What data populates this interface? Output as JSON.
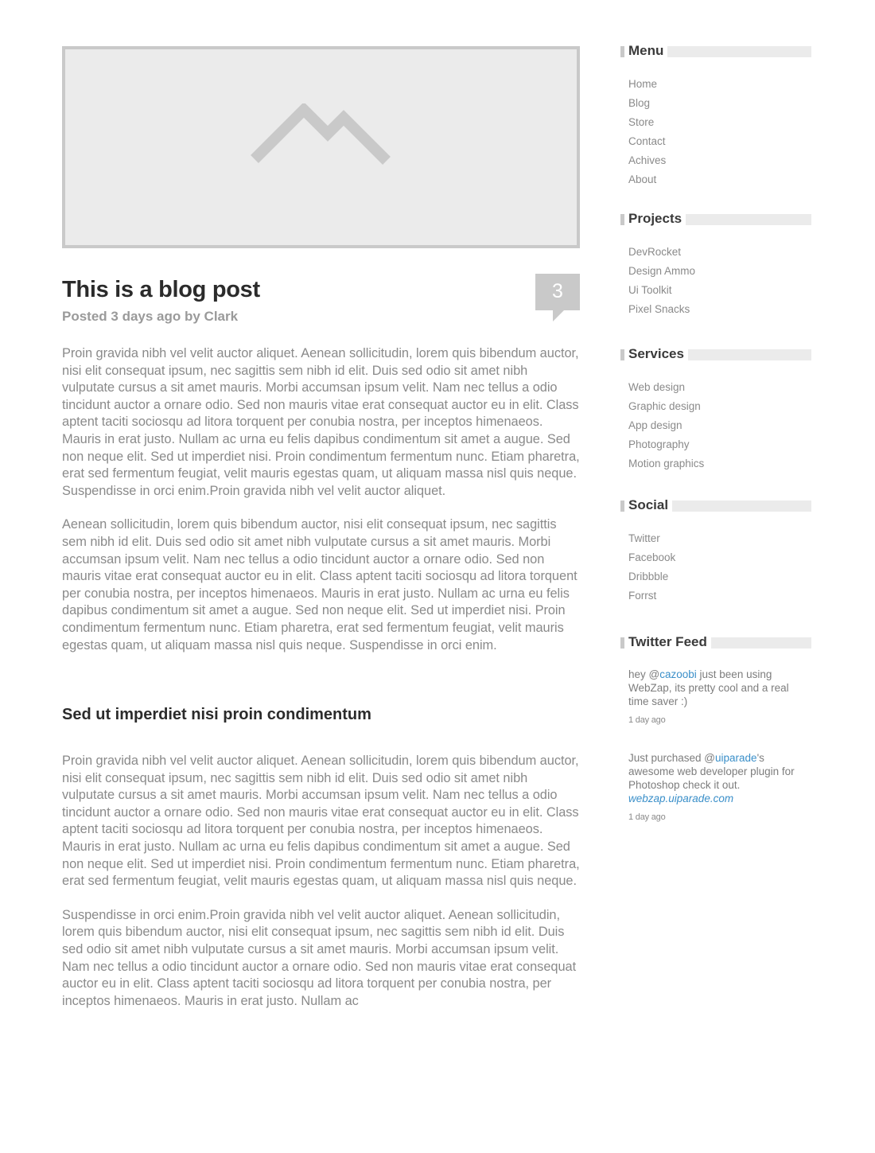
{
  "post": {
    "title": "This is a blog post",
    "meta": "Posted 3 days ago by Clark",
    "comment_count": "3",
    "paragraphs": [
      "Proin gravida nibh vel velit auctor aliquet. Aenean sollicitudin, lorem quis bibendum auctor, nisi elit consequat ipsum, nec sagittis sem nibh id elit. Duis sed odio sit amet nibh vulputate cursus a sit amet mauris. Morbi accumsan ipsum velit. Nam nec tellus a odio tincidunt auctor a ornare odio. Sed non  mauris vitae erat consequat auctor eu in elit. Class aptent taciti sociosqu ad litora torquent per conubia nostra, per inceptos himenaeos. Mauris in erat justo. Nullam ac urna eu felis dapibus condimentum sit amet a augue. Sed non neque elit. Sed ut imperdiet nisi. Proin condimentum fermentum nunc. Etiam pharetra, erat sed fermentum feugiat, velit mauris egestas quam, ut aliquam massa nisl quis neque. Suspendisse in orci enim.Proin gravida nibh vel velit auctor aliquet.",
      "Aenean sollicitudin, lorem quis bibendum auctor, nisi elit consequat ipsum, nec sagittis sem nibh id elit. Duis sed odio sit amet nibh vulputate cursus a sit amet mauris. Morbi accumsan ipsum velit. Nam nec tellus a odio tincidunt auctor a ornare odio. Sed non  mauris vitae erat consequat auctor eu in elit. Class aptent taciti sociosqu ad litora torquent per conubia nostra, per inceptos himenaeos. Mauris in erat justo. Nullam ac urna eu felis dapibus condimentum sit amet a augue. Sed non neque elit. Sed ut imperdiet nisi. Proin condimentum fermentum nunc. Etiam pharetra, erat sed fermentum feugiat, velit mauris egestas quam, ut aliquam massa nisl quis neque. Suspendisse in orci enim."
    ],
    "subheading": "Sed ut imperdiet nisi proin condimentum",
    "paragraphs2": [
      "Proin gravida nibh vel velit auctor aliquet. Aenean sollicitudin, lorem quis bibendum auctor, nisi elit consequat ipsum, nec sagittis sem nibh id elit. Duis sed odio sit amet nibh vulputate cursus a sit amet mauris. Morbi accumsan ipsum velit. Nam nec tellus a odio tincidunt auctor a ornare odio. Sed non  mauris vitae erat consequat auctor eu in elit. Class aptent taciti sociosqu ad litora torquent per conubia nostra, per inceptos himenaeos. Mauris in erat justo. Nullam ac urna eu felis dapibus condimentum sit amet a augue. Sed non neque elit. Sed ut imperdiet nisi. Proin condimentum fermentum nunc. Etiam pharetra, erat sed fermentum feugiat, velit mauris egestas quam, ut aliquam massa nisl quis neque.",
      "Suspendisse in orci enim.Proin gravida nibh vel velit auctor aliquet. Aenean sollicitudin, lorem quis bibendum auctor, nisi elit consequat ipsum, nec sagittis sem nibh id elit. Duis sed odio sit amet nibh vulputate cursus a sit amet mauris. Morbi accumsan ipsum velit. Nam nec tellus a odio tincidunt auctor a ornare odio. Sed non mauris vitae erat consequat auctor eu in elit. Class aptent taciti sociosqu ad litora torquent per conubia nostra, per inceptos himenaeos. Mauris in erat justo. Nullam ac"
    ]
  },
  "hero": {
    "icon": "image-placeholder-icon"
  },
  "sidebar": {
    "menu": {
      "title": "Menu",
      "items": [
        "Home",
        "Blog",
        "Store",
        "Contact",
        "Achives",
        "About"
      ]
    },
    "projects": {
      "title": "Projects",
      "items": [
        "DevRocket",
        "Design Ammo",
        "Ui Toolkit",
        "Pixel Snacks"
      ]
    },
    "services": {
      "title": "Services",
      "items": [
        "Web design",
        "Graphic design",
        "App design",
        "Photography",
        "Motion graphics"
      ]
    },
    "social": {
      "title": "Social",
      "items": [
        "Twitter",
        "Facebook",
        "Dribbble",
        "Forrst"
      ]
    },
    "twitter": {
      "title": "Twitter Feed",
      "tweets": [
        {
          "pre": "hey @",
          "handle": "cazoobi",
          "post": " just been using WebZap, its pretty cool and a real time saver :)",
          "link": "",
          "time": "1 day ago"
        },
        {
          "pre": "Just purchased @",
          "handle": "uiparade",
          "post": "'s awesome web developer plugin for Photoshop check it out.",
          "link": "webzap.uiparade.com",
          "time": "1 day ago"
        }
      ]
    }
  },
  "colors": {
    "link": "#3a8fc9",
    "placeholder_bg": "#ebebeb",
    "placeholder_border": "#c9c9c9"
  }
}
